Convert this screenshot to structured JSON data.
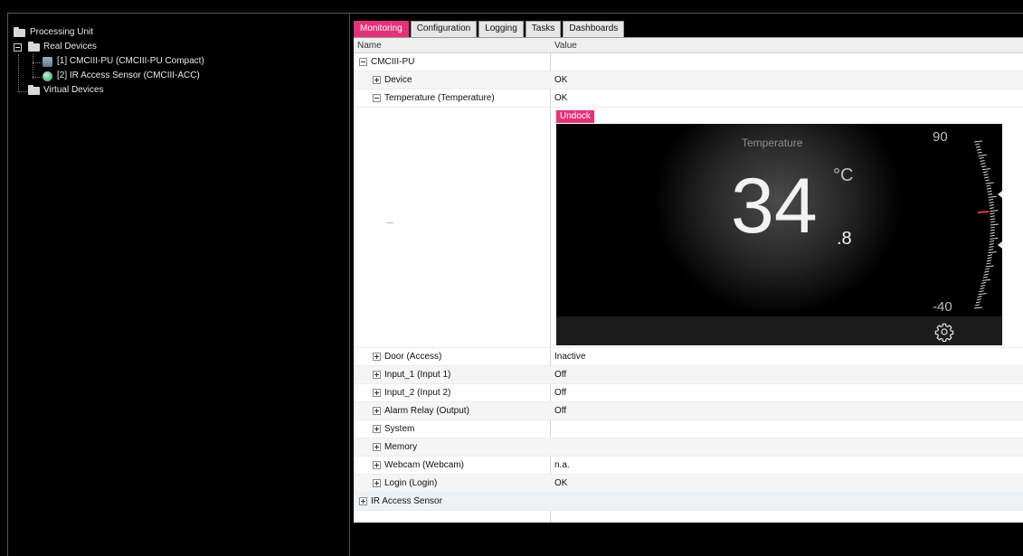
{
  "tree": {
    "root": "Processing Unit",
    "real_devices": "Real Devices",
    "device1": "[1] CMCIII-PU (CMCIII-PU Compact)",
    "device2": "[2] IR Access Sensor (CMCIII-ACC)",
    "virtual_devices": "Virtual Devices"
  },
  "tabs": [
    "Monitoring",
    "Configuration",
    "Logging",
    "Tasks",
    "Dashboards"
  ],
  "grid": {
    "col_name": "Name",
    "col_value": "Value",
    "group": "CMCIII-PU",
    "rows_top": [
      {
        "name": "Device",
        "value": "OK"
      },
      {
        "name": "Temperature (Temperature)",
        "value": "OK"
      }
    ],
    "rows_bottom": [
      {
        "name": "Door (Access)",
        "value": "Inactive"
      },
      {
        "name": "Input_1 (Input 1)",
        "value": "Off"
      },
      {
        "name": "Input_2 (Input 2)",
        "value": "Off"
      },
      {
        "name": "Alarm Relay (Output)",
        "value": "Off"
      },
      {
        "name": "System",
        "value": ""
      },
      {
        "name": "Memory",
        "value": ""
      },
      {
        "name": "Webcam (Webcam)",
        "value": "n.a."
      },
      {
        "name": "Login (Login)",
        "value": "OK"
      }
    ],
    "last_group": "IR Access Sensor"
  },
  "widget": {
    "undock": "Undock",
    "title": "Temperature",
    "value_int": "34",
    "value_dec": ".8",
    "unit": "°C",
    "max": "90",
    "min": "-40",
    "gear_icon": "gear-icon",
    "accent": "#e5307a",
    "marker_color": "#e23a3a"
  }
}
